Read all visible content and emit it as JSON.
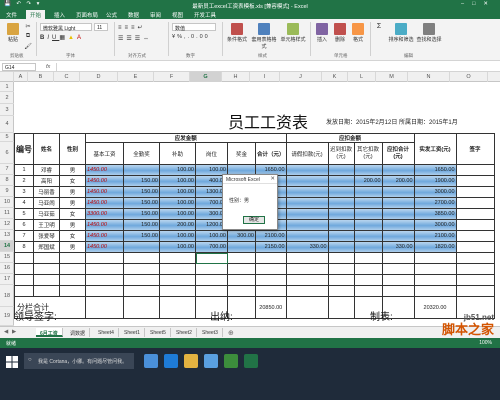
{
  "window": {
    "title": "最新员工excel工资表模板.xls  [兼容模式] - Excel",
    "qat": "💾 ↶ ↷ ▾"
  },
  "ribbon": {
    "tabs": [
      "文件",
      "开始",
      "插入",
      "页面布局",
      "公式",
      "数据",
      "审阅",
      "视图",
      "开发工具"
    ],
    "active_tab": 1,
    "font_name": "微软雅黑 Light",
    "font_size": "11",
    "number_format": "数值",
    "buttons": {
      "paste": "粘贴",
      "cond_format": "条件格式",
      "table_format": "套用表格格式",
      "cell_style": "单元格样式",
      "insert": "插入",
      "delete": "删除",
      "format": "格式",
      "sort_filter": "排序和筛选",
      "find_select": "查找和选择"
    },
    "groups": [
      "剪贴板",
      "字体",
      "对齐方式",
      "数字",
      "样式",
      "单元格",
      "编辑"
    ]
  },
  "formula_bar": {
    "name_box": "G14",
    "fx": "fx",
    "value": ""
  },
  "columns": [
    "A",
    "B",
    "C",
    "D",
    "E",
    "F",
    "G",
    "H",
    "I",
    "J",
    "K",
    "L",
    "M",
    "N",
    "O"
  ],
  "selected_column": "G",
  "rows": [
    "1",
    "2",
    "3",
    "4",
    "5",
    "6",
    "7",
    "8",
    "9",
    "10",
    "11",
    "12",
    "13",
    "14",
    "15",
    "16",
    "17",
    "18",
    "19"
  ],
  "selected_row": "14",
  "sheet": {
    "title": "员工工资表",
    "meta": "发放日期：2015年2月12日  所属日期：2015年1月",
    "headers": {
      "no": "编号",
      "name": "姓名",
      "gender": "性别",
      "pay_group": "应发金额",
      "deduct_group": "应扣金额",
      "base": "基本工资",
      "attend": "全勤奖",
      "subsidy": "补助",
      "post": "岗位",
      "bonus": "奖金",
      "total": "合计（元）",
      "leave": "请假扣款(元)",
      "late": "迟到扣款(元)",
      "other": "其它扣款(元)",
      "deduct_total": "应扣合计(元)",
      "net": "实发工资(元)",
      "sign": "签字"
    },
    "employees": [
      {
        "no": "1",
        "name": "邓睿",
        "gender": "男",
        "base": "1450.00",
        "attend": "",
        "subsidy": "100.00",
        "post": "100.00",
        "bonus": "",
        "total": "1650.00",
        "leave": "",
        "late": "",
        "other": "",
        "deduct_total": "",
        "net": "1650.00"
      },
      {
        "no": "2",
        "name": "高阳",
        "gender": "女",
        "base": "1450.00",
        "attend": "150.00",
        "subsidy": "100.00",
        "post": "400.00",
        "bonus": "",
        "total": "",
        "leave": "",
        "late": "",
        "other": "200.00",
        "deduct_total": "200.00",
        "net": "1900.00"
      },
      {
        "no": "3",
        "name": "马丽香",
        "gender": "男",
        "base": "1450.00",
        "attend": "150.00",
        "subsidy": "100.00",
        "post": "1300.00",
        "bonus": "",
        "total": "",
        "leave": "",
        "late": "",
        "other": "",
        "deduct_total": "",
        "net": "3000.00"
      },
      {
        "no": "4",
        "name": "马亚闹",
        "gender": "男",
        "base": "1450.00",
        "attend": "150.00",
        "subsidy": "100.00",
        "post": "700.00",
        "bonus": "",
        "total": "",
        "leave": "",
        "late": "",
        "other": "",
        "deduct_total": "",
        "net": "2700.00"
      },
      {
        "no": "5",
        "name": "马亚茹",
        "gender": "女",
        "base": "3300.00",
        "attend": "150.00",
        "subsidy": "100.00",
        "post": "300.00",
        "bonus": "",
        "total": "",
        "leave": "",
        "late": "",
        "other": "",
        "deduct_total": "",
        "net": "3850.00"
      },
      {
        "no": "6",
        "name": "王卫明",
        "gender": "男",
        "base": "1450.00",
        "attend": "150.00",
        "subsidy": "200.00",
        "post": "1200.00",
        "bonus": "",
        "total": "",
        "leave": "",
        "late": "",
        "other": "",
        "deduct_total": "",
        "net": "3000.00"
      },
      {
        "no": "7",
        "name": "张爱琴",
        "gender": "女",
        "base": "1450.00",
        "attend": "150.00",
        "subsidy": "100.00",
        "post": "100.00",
        "bonus": "300.00",
        "total": "2100.00",
        "leave": "",
        "late": "",
        "other": "",
        "deduct_total": "",
        "net": "2100.00"
      },
      {
        "no": "8",
        "name": "郑国斌",
        "gender": "男",
        "base": "1450.00",
        "attend": "",
        "subsidy": "100.00",
        "post": "700.00",
        "bonus": "",
        "total": "2150.00",
        "leave": "330.00",
        "late": "",
        "other": "",
        "deduct_total": "330.00",
        "net": "1820.00"
      }
    ],
    "subtotal_label": "分栏合计",
    "subtotal_total": "20850.00",
    "subtotal_net": "20320.00",
    "footer": {
      "leader": "领导签字:",
      "cashier": "出纳:",
      "preparer": "制表:"
    }
  },
  "msgbox": {
    "title": "Microsoft Excel",
    "close": "✕",
    "text": "性别：男",
    "ok": "确定"
  },
  "sheet_tabs": [
    "6月工资",
    "调数据",
    "Sheet4",
    "Sheet1",
    "Sheet5",
    "Sheet2",
    "Sheet3"
  ],
  "active_sheet": 0,
  "status": {
    "ready": "就绪",
    "zoom": "100%"
  },
  "taskbar": {
    "search_placeholder": "我是 Cortana，小娜。有问题尽管问我。"
  },
  "watermark": {
    "site": "jb51.net",
    "brand": "脚本之家"
  },
  "colors": {
    "excel_green": "#217346",
    "row_highlight": "#6fa8dc",
    "red_text": "#c00000"
  }
}
